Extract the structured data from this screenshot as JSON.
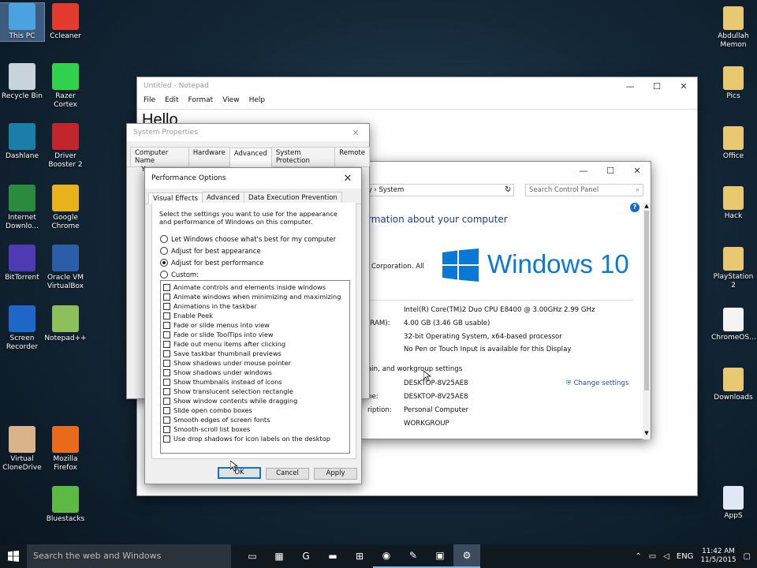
{
  "desktop": {
    "left_icons": [
      {
        "label": "This PC",
        "icon": "computer-icon",
        "color": "#4aa3df"
      },
      {
        "label": "Ccleaner",
        "icon": "ccleaner-icon",
        "color": "#e23b2e"
      },
      {
        "label": "Recycle Bin",
        "icon": "recycle-bin-icon",
        "color": "#c8d4dc"
      },
      {
        "label": "Razer Cortex",
        "icon": "razer-cortex-icon",
        "color": "#2fd24a"
      },
      {
        "label": "Dashlane",
        "icon": "dashlane-icon",
        "color": "#1a7fa8"
      },
      {
        "label": "Driver Booster 2",
        "icon": "driver-booster-icon",
        "color": "#c0262b"
      },
      {
        "label": "Internet Downlo...",
        "icon": "internet-download-manager-icon",
        "color": "#2b8a3e"
      },
      {
        "label": "Google Chrome",
        "icon": "chrome-icon",
        "color": "#e8b21c"
      },
      {
        "label": "BitTorrent",
        "icon": "bittorrent-icon",
        "color": "#4e3bb3"
      },
      {
        "label": "Oracle VM VirtualBox",
        "icon": "virtualbox-icon",
        "color": "#2b5ea8"
      },
      {
        "label": "Screen Recorder",
        "icon": "screen-recorder-icon",
        "color": "#1e66c8"
      },
      {
        "label": "Notepad++",
        "icon": "notepadpp-icon",
        "color": "#8dbf5a"
      },
      {
        "label": "Virtual CloneDrive",
        "icon": "clonedrive-icon",
        "color": "#d9b48a"
      },
      {
        "label": "Mozilla Firefox",
        "icon": "firefox-icon",
        "color": "#e86a1a"
      },
      {
        "label": "Bluestacks",
        "icon": "bluestacks-icon",
        "color": "#5bb944"
      }
    ],
    "right_icons": [
      {
        "label": "Abdullah Memon",
        "icon": "user-folder-icon",
        "color": "#e8c870"
      },
      {
        "label": "Pics",
        "icon": "folder-icon",
        "color": "#e8c870"
      },
      {
        "label": "Office",
        "icon": "folder-icon",
        "color": "#e8c870"
      },
      {
        "label": "Hack",
        "icon": "folder-icon",
        "color": "#e8c870"
      },
      {
        "label": "PlayStation 2",
        "icon": "folder-icon",
        "color": "#e8c870"
      },
      {
        "label": "ChromeOS...",
        "icon": "file-icon",
        "color": "#f4f4f4"
      },
      {
        "label": "Downloads",
        "icon": "downloads-folder-icon",
        "color": "#e8c870"
      },
      {
        "label": "AppS",
        "icon": "document-icon",
        "color": "#dfe8f4"
      }
    ]
  },
  "notepad": {
    "title": "Untitled - Notepad",
    "menu": [
      "File",
      "Edit",
      "Format",
      "View",
      "Help"
    ],
    "content": "Hello"
  },
  "system_window": {
    "breadcrumb": "ity  ›  System",
    "search_placeholder": "Search Control Panel",
    "heading": "rmation about your computer",
    "copyright": "Corporation. All",
    "logo_text": "Windows 10",
    "specs": [
      {
        "label": "",
        "value": "Intel(R) Core(TM)2 Duo CPU     E8400  @ 3.00GHz   2.99 GHz"
      },
      {
        "label": "(RAM):",
        "value": "4.00 GB (3.46 GB usable)"
      },
      {
        "label": "",
        "value": "32-bit Operating System, x64-based processor"
      },
      {
        "label": "",
        "value": "No Pen or Touch Input is available for this Display"
      }
    ],
    "section_title": "ain, and workgroup settings",
    "computer": [
      {
        "label": "",
        "value": "DESKTOP-8V25AE8"
      },
      {
        "label": "ne:",
        "value": "DESKTOP-8V25AE8"
      },
      {
        "label": "ription:",
        "value": "Personal Computer"
      },
      {
        "label": "",
        "value": "WORKGROUP"
      }
    ],
    "change_settings": "Change settings",
    "help_glyph": "?"
  },
  "system_properties": {
    "title": "System Properties",
    "tabs": [
      "Computer Name",
      "Hardware",
      "Advanced",
      "System Protection",
      "Remote"
    ],
    "peek_y": "Y",
    "peek_p": "P",
    "peek_u": "U",
    "peek_s": "S"
  },
  "performance_options": {
    "title": "Performance Options",
    "tabs": [
      "Visual Effects",
      "Advanced",
      "Data Execution Prevention"
    ],
    "description": "Select the settings you want to use for the appearance and performance of Windows on this computer.",
    "radios": [
      {
        "label": "Let Windows choose what's best for my computer",
        "selected": false
      },
      {
        "label": "Adjust for best appearance",
        "selected": false
      },
      {
        "label": "Adjust for best performance",
        "selected": true
      },
      {
        "label": "Custom:",
        "selected": false
      }
    ],
    "options": [
      "Animate controls and elements inside windows",
      "Animate windows when minimizing and maximizing",
      "Animations in the taskbar",
      "Enable Peek",
      "Fade or slide menus into view",
      "Fade or slide ToolTips into view",
      "Fade out menu items after clicking",
      "Save taskbar thumbnail previews",
      "Show shadows under mouse pointer",
      "Show shadows under windows",
      "Show thumbnails instead of icons",
      "Show translucent selection rectangle",
      "Show window contents while dragging",
      "Slide open combo boxes",
      "Smooth edges of screen fonts",
      "Smooth-scroll list boxes",
      "Use drop shadows for icon labels on the desktop"
    ],
    "ok_label": "OK",
    "cancel_label": "Cancel",
    "apply_label": "Apply"
  },
  "taskbar": {
    "search_placeholder": "Search the web and Windows",
    "language": "ENG",
    "time": "11:42 AM",
    "date": "11/5/2015",
    "apps": [
      {
        "name": "task-view-icon",
        "glyph": "▭",
        "state": ""
      },
      {
        "name": "calculator-icon",
        "glyph": "▦",
        "state": ""
      },
      {
        "name": "google-icon",
        "glyph": "G",
        "state": ""
      },
      {
        "name": "file-explorer-icon",
        "glyph": "▬",
        "state": ""
      },
      {
        "name": "store-icon",
        "glyph": "⊞",
        "state": ""
      },
      {
        "name": "chrome-taskbar-icon",
        "glyph": "◉",
        "state": "open"
      },
      {
        "name": "notepad-taskbar-icon",
        "glyph": "✎",
        "state": "open"
      },
      {
        "name": "system-taskbar-icon",
        "glyph": "▣",
        "state": "open"
      },
      {
        "name": "system-properties-taskbar-icon",
        "glyph": "⚙",
        "state": "active"
      }
    ]
  }
}
